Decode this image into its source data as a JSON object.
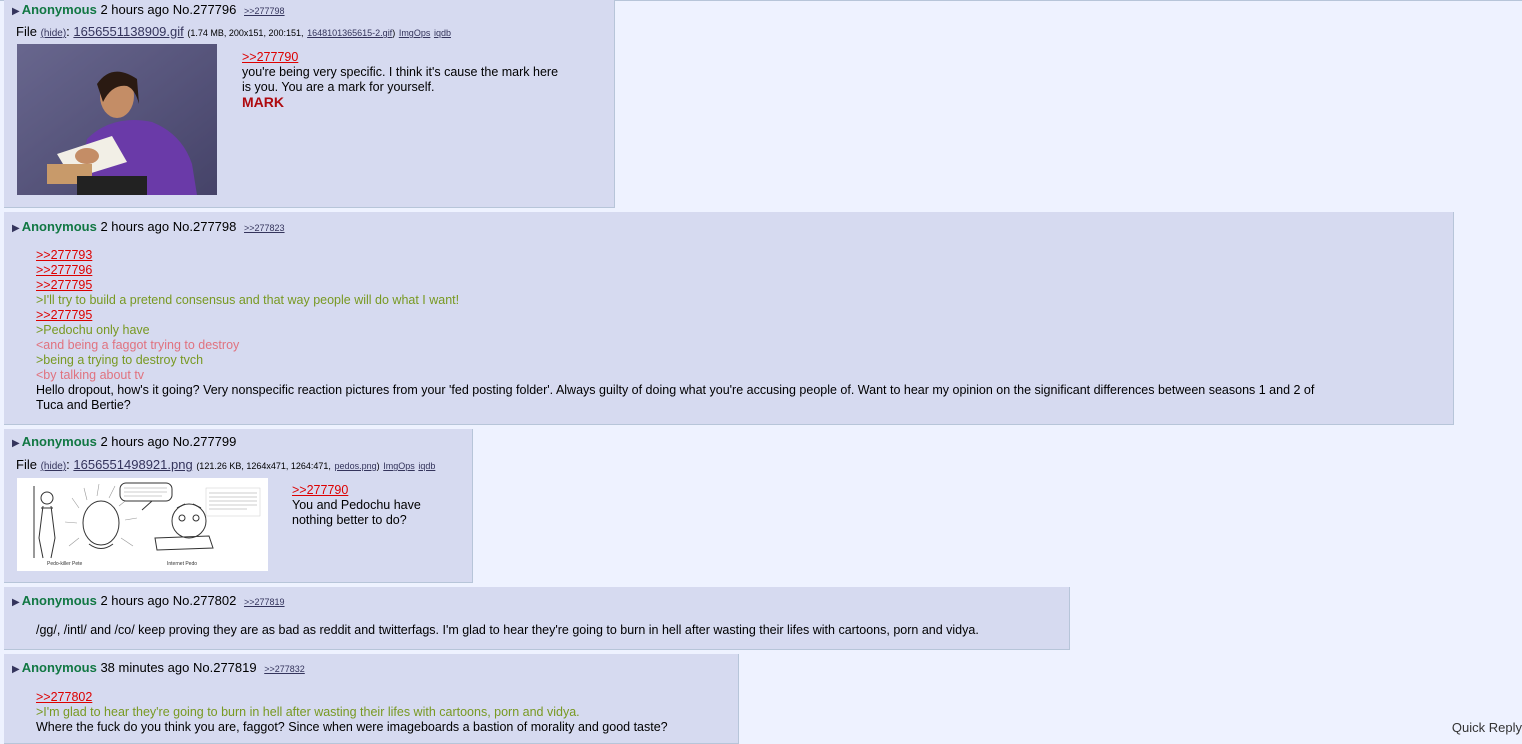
{
  "posts": [
    {
      "name": "Anonymous",
      "time": "2 hours ago",
      "no": "No.277796",
      "backlinks": ">>277798",
      "file": {
        "prefix": "File",
        "hide": "(hide)",
        "filename": "1656551138909.gif",
        "meta_pre": "(1.74 MB, 200x151, 200:151,",
        "orig_name": "1648101365615-2.gif",
        "meta_post": ")",
        "imgops": "ImgOps",
        "iqdb": "iqdb"
      },
      "lines": {
        "q1": ">>277790",
        "t1": "you're being very specific. I think it's cause the mark here",
        "t2": "is you.  You are a mark for yourself.",
        "t3": "MARK"
      }
    },
    {
      "name": "Anonymous",
      "time": "2 hours ago",
      "no": "No.277798",
      "backlinks": ">>277823",
      "lines": {
        "q1": ">>277793",
        "q2": ">>277796",
        "q3": ">>277795",
        "g1": ">I'll try to build a pretend consensus and that way people will do what I want!",
        "q4": ">>277795",
        "g2": ">Pedochu only have",
        "p1": "<and being a faggot trying to destroy",
        "g3": ">being a trying to destroy tvch",
        "p2": "<by talking about tv",
        "t1": "Hello dropout, how's it going? Very nonspecific reaction pictures from your 'fed posting folder'. Always guilty of doing what you're accusing people of. Want to hear my opinion on the significant differences between seasons 1 and 2 of",
        "t2": "Tuca and Bertie?"
      }
    },
    {
      "name": "Anonymous",
      "time": "2 hours ago",
      "no": "No.277799",
      "file": {
        "prefix": "File",
        "hide": "(hide)",
        "filename": "1656551498921.png",
        "meta_pre": "(121.26 KB, 1264x471, 1264:471,",
        "orig_name": "pedos.png",
        "meta_post": ")",
        "imgops": "ImgOps",
        "iqdb": "iqdb"
      },
      "thumb_labels": {
        "left": "Pedo-killer Pete",
        "right": "Internet Pedo"
      },
      "lines": {
        "q1": ">>277790",
        "t1": "You and Pedochu have",
        "t2": "nothing better to do?"
      }
    },
    {
      "name": "Anonymous",
      "time": "2 hours ago",
      "no": "No.277802",
      "backlinks": ">>277819",
      "lines": {
        "t1": "/gg/, /intl/ and /co/ keep proving they are as bad as reddit and twitterfags. I'm glad to hear they're going to burn in hell after wasting their lifes with cartoons, porn and vidya."
      }
    },
    {
      "name": "Anonymous",
      "time": "38 minutes ago",
      "no": "No.277819",
      "backlinks": ">>277832",
      "lines": {
        "q1": ">>277802",
        "g1": ">I'm glad to hear they're going to burn in hell after wasting their lifes with cartoons, porn and vidya.",
        "t1": "Where the fuck do you think you are, faggot? Since when were imageboards a bastion of morality and good taste?"
      }
    }
  ],
  "quick_reply": "Quick Reply",
  "colors": {
    "post_bg": "#d6daf0",
    "page_bg": "#eef2ff",
    "name": "#117743",
    "greentext": "#789922",
    "quotelink": "#dd0000"
  }
}
